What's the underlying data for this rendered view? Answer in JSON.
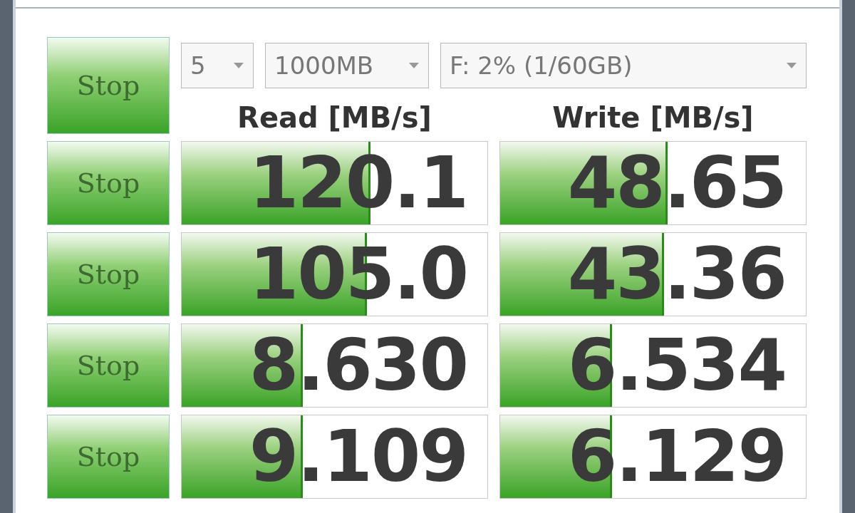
{
  "toolbar": {
    "all_button": "Stop",
    "test_count": "5",
    "test_size": "1000MB",
    "drive": "F: 2% (1/60GB)"
  },
  "headers": {
    "read": "Read [MB/s]",
    "write": "Write [MB/s]"
  },
  "rows": [
    {
      "button": "Stop",
      "read": {
        "value": "120.1",
        "level": 0.61
      },
      "write": {
        "value": "48.65",
        "level": 0.54
      }
    },
    {
      "button": "Stop",
      "read": {
        "value": "105.0",
        "level": 0.6
      },
      "write": {
        "value": "43.36",
        "level": 0.53
      }
    },
    {
      "button": "Stop",
      "read": {
        "value": "8.630",
        "level": 0.39
      },
      "write": {
        "value": "6.534",
        "level": 0.36
      }
    },
    {
      "button": "Stop",
      "read": {
        "value": "9.109",
        "level": 0.39
      },
      "write": {
        "value": "6.129",
        "level": 0.36
      }
    }
  ]
}
